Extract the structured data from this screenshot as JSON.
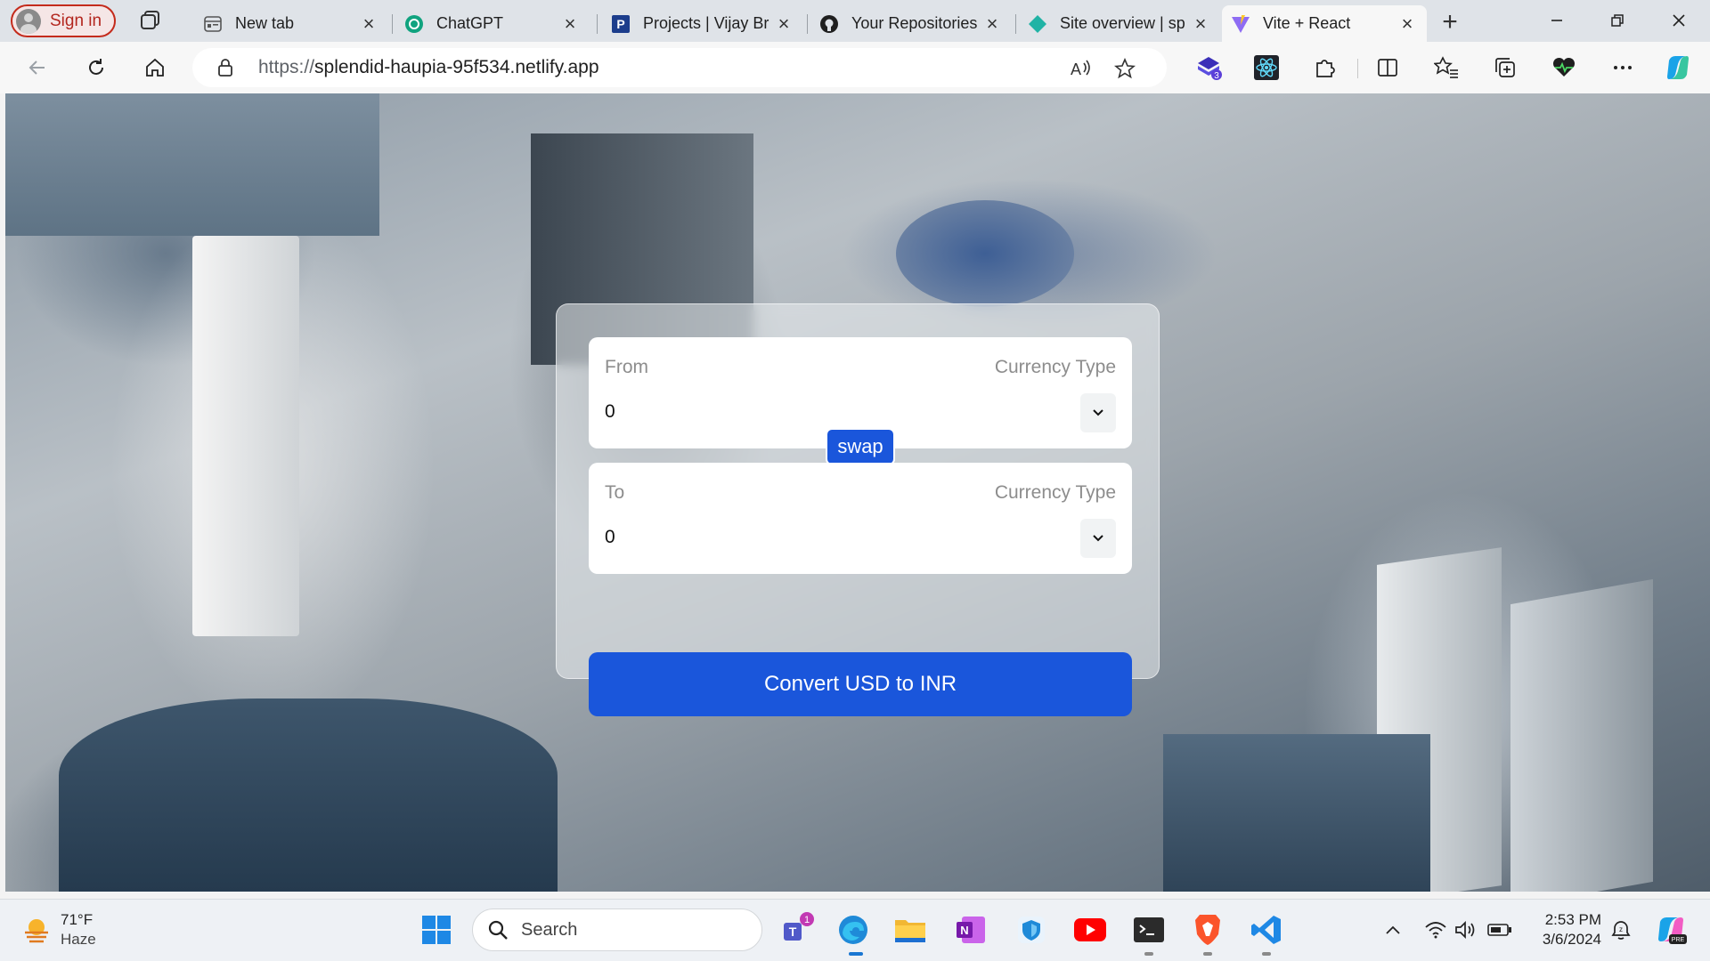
{
  "browser": {
    "profile_label": "Sign in",
    "tabs": [
      {
        "title": "New tab",
        "icon": "new-tab-icon"
      },
      {
        "title": "ChatGPT",
        "icon": "chatgpt-icon"
      },
      {
        "title": "Projects | Vijay Br",
        "icon": "projects-icon"
      },
      {
        "title": "Your Repositories",
        "icon": "github-icon"
      },
      {
        "title": "Site overview | sp",
        "icon": "netlify-icon"
      },
      {
        "title": "Vite + React",
        "icon": "vite-icon",
        "active": true
      }
    ],
    "address": {
      "protocol": "https://",
      "host": "splendid-haupia-95f534.netlify.app"
    },
    "extension_badge": "3"
  },
  "app": {
    "from_label": "From",
    "from_currency_label": "Currency Type",
    "from_amount": "0",
    "swap_label": "swap",
    "to_label": "To",
    "to_currency_label": "Currency Type",
    "to_amount": "0",
    "convert_label": "Convert USD to INR",
    "accent_color": "#1a56db"
  },
  "taskbar": {
    "weather_temp": "71°F",
    "weather_cond": "Haze",
    "search_placeholder": "Search",
    "teams_badge": "1",
    "time": "2:53 PM",
    "date": "3/6/2024"
  }
}
